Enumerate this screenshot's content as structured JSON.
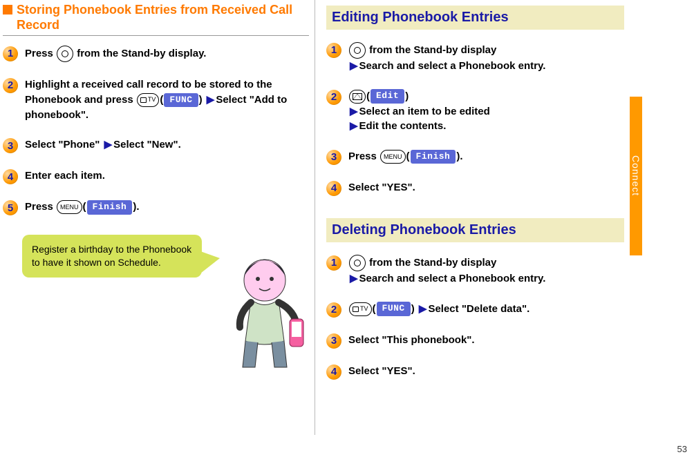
{
  "side_tab": "Connect",
  "page_number": "53",
  "left": {
    "subheading": "Storing Phonebook Entries from Received Call Record",
    "steps": {
      "s1": {
        "num": "1",
        "a": "Press ",
        "b": " from the Stand-by display."
      },
      "s2": {
        "num": "2",
        "a": "Highlight a received call record to be stored to the Phonebook and press ",
        "cam_label": "TV",
        "func": "FUNC",
        "b": "Select \"Add to phonebook\"."
      },
      "s3": {
        "num": "3",
        "a": "Select \"Phone\"",
        "b": "Select \"New\"."
      },
      "s4": {
        "num": "4",
        "a": "Enter each item."
      },
      "s5": {
        "num": "5",
        "a": "Press ",
        "menu_label": "MENU",
        "finish": "Finish",
        "b": "."
      }
    },
    "tip": "Register a birthday to the Phonebook to have it shown on Schedule."
  },
  "right": {
    "editing_heading": "Editing Phonebook Entries",
    "editing": {
      "s1": {
        "num": "1",
        "a": " from the Stand-by display",
        "b": "Search and select a Phonebook entry."
      },
      "s2": {
        "num": "2",
        "edit": "Edit",
        "b": "Select an item to be edited",
        "c": "Edit the contents."
      },
      "s3": {
        "num": "3",
        "a": "Press ",
        "menu_label": "MENU",
        "finish": "Finish",
        "b": "."
      },
      "s4": {
        "num": "4",
        "a": "Select \"YES\"."
      }
    },
    "deleting_heading": "Deleting Phonebook Entries",
    "deleting": {
      "s1": {
        "num": "1",
        "a": " from the Stand-by display",
        "b": "Search and select a Phonebook entry."
      },
      "s2": {
        "num": "2",
        "cam_label": "TV",
        "func": "FUNC",
        "b": "Select \"Delete data\"."
      },
      "s3": {
        "num": "3",
        "a": "Select \"This phonebook\"."
      },
      "s4": {
        "num": "4",
        "a": "Select \"YES\"."
      }
    }
  }
}
